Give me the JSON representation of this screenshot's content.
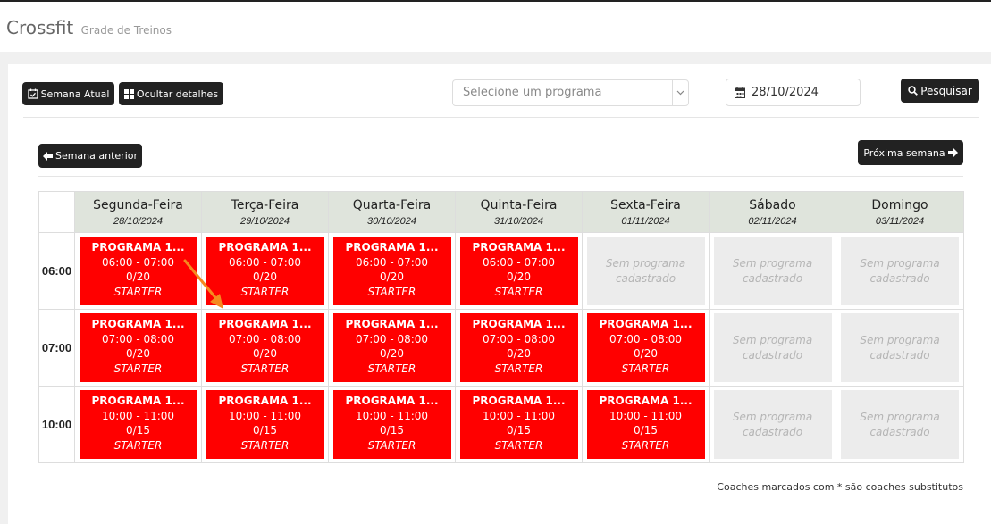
{
  "header": {
    "title": "Crossfit",
    "subtitle": "Grade de Treinos"
  },
  "toolbar": {
    "current_week_label": "Semana Atual",
    "hide_details_label": "Ocultar detalhes",
    "program_placeholder": "Selecione um programa",
    "date_value": "28/10/2024",
    "search_label": "Pesquisar"
  },
  "nav": {
    "prev_week_label": "Semana anterior",
    "next_week_label": "Próxima semana"
  },
  "days": [
    {
      "name": "Segunda-Feira",
      "date": "28/10/2024"
    },
    {
      "name": "Terça-Feira",
      "date": "29/10/2024"
    },
    {
      "name": "Quarta-Feira",
      "date": "30/10/2024"
    },
    {
      "name": "Quinta-Feira",
      "date": "31/10/2024"
    },
    {
      "name": "Sexta-Feira",
      "date": "01/11/2024"
    },
    {
      "name": "Sábado",
      "date": "02/11/2024"
    },
    {
      "name": "Domingo",
      "date": "03/11/2024"
    }
  ],
  "empty_slot_text": "Sem programa cadastrado",
  "rows": [
    {
      "time": "06:00",
      "slots": [
        {
          "program": "PROGRAMA 1...",
          "hours": "06:00 - 07:00",
          "capacity": "0/20",
          "level": "STARTER"
        },
        {
          "program": "PROGRAMA 1...",
          "hours": "06:00 - 07:00",
          "capacity": "0/20",
          "level": "STARTER"
        },
        {
          "program": "PROGRAMA 1...",
          "hours": "06:00 - 07:00",
          "capacity": "0/20",
          "level": "STARTER"
        },
        {
          "program": "PROGRAMA 1...",
          "hours": "06:00 - 07:00",
          "capacity": "0/20",
          "level": "STARTER"
        },
        null,
        null,
        null
      ]
    },
    {
      "time": "07:00",
      "slots": [
        {
          "program": "PROGRAMA 1...",
          "hours": "07:00 - 08:00",
          "capacity": "0/20",
          "level": "STARTER"
        },
        {
          "program": "PROGRAMA 1...",
          "hours": "07:00 - 08:00",
          "capacity": "0/20",
          "level": "STARTER"
        },
        {
          "program": "PROGRAMA 1...",
          "hours": "07:00 - 08:00",
          "capacity": "0/20",
          "level": "STARTER"
        },
        {
          "program": "PROGRAMA 1...",
          "hours": "07:00 - 08:00",
          "capacity": "0/20",
          "level": "STARTER"
        },
        {
          "program": "PROGRAMA 1...",
          "hours": "07:00 - 08:00",
          "capacity": "0/20",
          "level": "STARTER"
        },
        null,
        null
      ]
    },
    {
      "time": "10:00",
      "slots": [
        {
          "program": "PROGRAMA 1...",
          "hours": "10:00 - 11:00",
          "capacity": "0/15",
          "level": "STARTER"
        },
        {
          "program": "PROGRAMA 1...",
          "hours": "10:00 - 11:00",
          "capacity": "0/15",
          "level": "STARTER"
        },
        {
          "program": "PROGRAMA 1...",
          "hours": "10:00 - 11:00",
          "capacity": "0/15",
          "level": "STARTER"
        },
        {
          "program": "PROGRAMA 1...",
          "hours": "10:00 - 11:00",
          "capacity": "0/15",
          "level": "STARTER"
        },
        {
          "program": "PROGRAMA 1...",
          "hours": "10:00 - 11:00",
          "capacity": "0/15",
          "level": "STARTER"
        },
        null,
        null
      ]
    }
  ],
  "footer_note": "Coaches marcados com * são coaches substitutos",
  "colors": {
    "slot": "#ff0000",
    "header_bg": "#dfe4dc",
    "button": "#222222",
    "annotation_arrow": "#f5891f"
  }
}
